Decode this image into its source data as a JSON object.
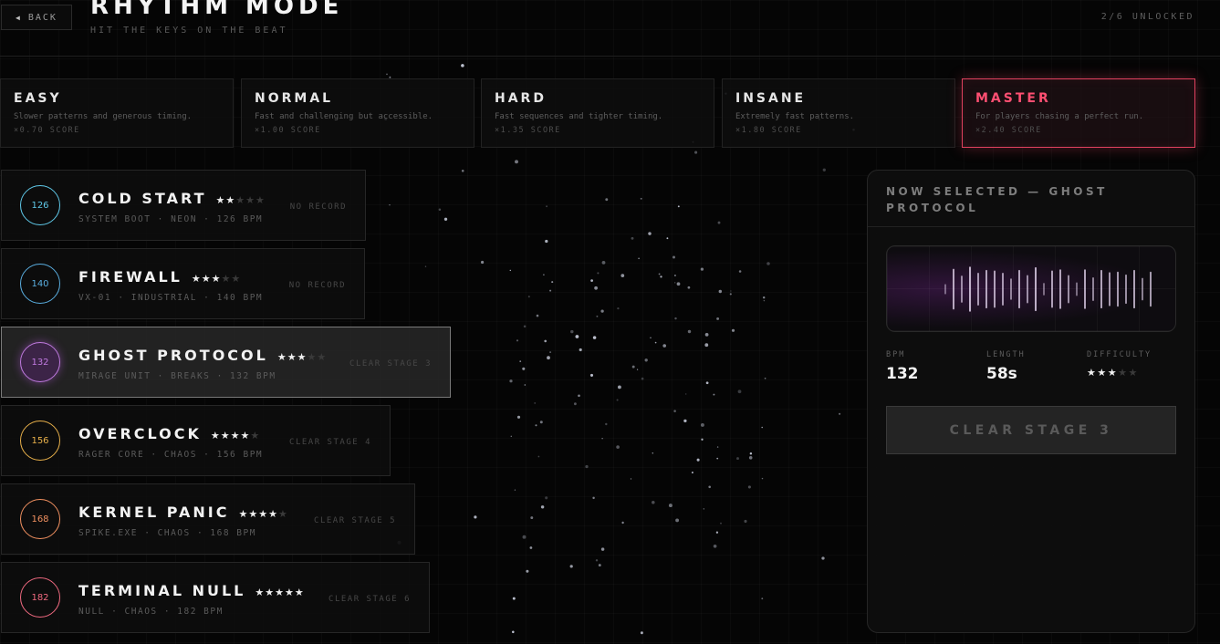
{
  "header": {
    "back_label": "BACK",
    "back_icon": "left-triangle",
    "title": "RHYTHM MODE",
    "subtitle": "HIT THE KEYS ON THE BEAT",
    "unlock_status": "2/6 UNLOCKED"
  },
  "difficulties": [
    {
      "name": "EASY",
      "description": "Slower patterns and generous timing.",
      "multiplier": "×0.70 SCORE",
      "selected": false
    },
    {
      "name": "NORMAL",
      "description": "Fast and challenging but accessible.",
      "multiplier": "×1.00 SCORE",
      "selected": false
    },
    {
      "name": "HARD",
      "description": "Fast sequences and tighter timing.",
      "multiplier": "×1.35 SCORE",
      "selected": false
    },
    {
      "name": "INSANE",
      "description": "Extremely fast patterns.",
      "multiplier": "×1.80 SCORE",
      "selected": false
    },
    {
      "name": "MASTER",
      "description": "For players chasing a perfect run.",
      "multiplier": "×2.40 SCORE",
      "selected": true
    }
  ],
  "tracks": [
    {
      "bpm": "126",
      "name": "COLD START",
      "stars": 2,
      "meta": "SYSTEM BOOT · NEON · 126 BPM",
      "status": "NO RECORD",
      "color": "#5fc8e8",
      "selected": false
    },
    {
      "bpm": "140",
      "name": "FIREWALL",
      "stars": 3,
      "meta": "VX-01 · INDUSTRIAL · 140 BPM",
      "status": "NO RECORD",
      "color": "#5aaee0",
      "selected": false
    },
    {
      "bpm": "132",
      "name": "GHOST PROTOCOL",
      "stars": 3,
      "meta": "MIRAGE UNIT · BREAKS · 132 BPM",
      "status": "CLEAR STAGE 3",
      "color": "#c07ae0",
      "selected": true
    },
    {
      "bpm": "156",
      "name": "OVERCLOCK",
      "stars": 4,
      "meta": "RAGER CORE · CHAOS · 156 BPM",
      "status": "CLEAR STAGE 4",
      "color": "#e8b04a",
      "selected": false
    },
    {
      "bpm": "168",
      "name": "KERNEL PANIC",
      "stars": 4,
      "meta": "SPIKE.EXE · CHAOS · 168 BPM",
      "status": "CLEAR STAGE 5",
      "color": "#f09060",
      "selected": false
    },
    {
      "bpm": "182",
      "name": "TERMINAL NULL",
      "stars": 5,
      "meta": "NULL · CHAOS · 182 BPM",
      "status": "CLEAR STAGE 6",
      "color": "#f06a80",
      "selected": false
    }
  ],
  "detail": {
    "heading": "NOW SELECTED — GHOST PROTOCOL",
    "stat_labels": {
      "bpm": "BPM",
      "length": "LENGTH",
      "difficulty": "DIFFICULTY"
    },
    "bpm": "132",
    "length": "58s",
    "difficulty_stars": 3,
    "action_label": "CLEAR STAGE 3",
    "waveform_levels": [
      0.18,
      0.72,
      0.48,
      0.8,
      0.58,
      0.68,
      0.66,
      0.58,
      0.38,
      0.68,
      0.5,
      0.78,
      0.22,
      0.66,
      0.7,
      0.5,
      0.24,
      0.7,
      0.42,
      0.68,
      0.6,
      0.62,
      0.52,
      0.68,
      0.4,
      0.62
    ]
  },
  "colors": {
    "accent": "#ff4f72",
    "background": "#050505"
  },
  "max_stars": 5
}
